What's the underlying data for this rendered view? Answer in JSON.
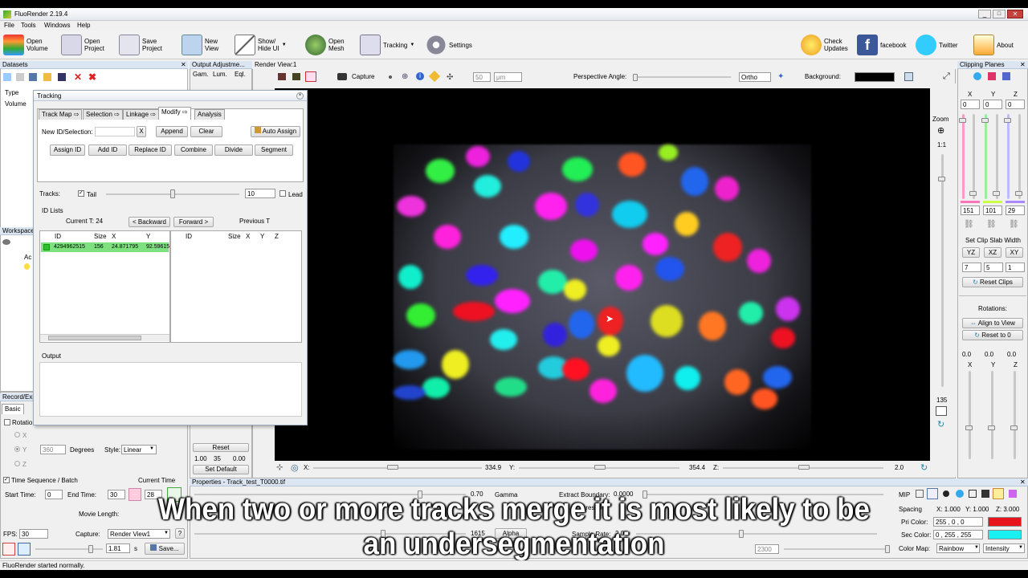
{
  "window": {
    "title": "FluoRender 2.19.4"
  },
  "menu": [
    "File",
    "Tools",
    "Windows",
    "Help"
  ],
  "toolbar": {
    "open_volume": "Open\nVolume",
    "open_project": "Open\nProject",
    "save_project": "Save\nProject",
    "new_view": "New\nView",
    "show_hide_ui": "Show/\nHide UI",
    "open_mesh": "Open\nMesh",
    "tracking": "Tracking",
    "settings": "Settings",
    "check_updates": "Check\nUpdates",
    "facebook": "facebook",
    "twitter": "Twitter",
    "about": "About"
  },
  "datasets": {
    "title": "Datasets",
    "col_type": "Type",
    "row_volume": "Volume"
  },
  "workspace": {
    "title": "Workspace",
    "item": "Ac"
  },
  "output_adjust": {
    "title": "Output Adjustme...",
    "gam": "Gam.",
    "lum": "Lum.",
    "eql": "Eql.",
    "reset": "Reset",
    "vals": [
      "1.00",
      "35",
      "0.00"
    ],
    "set_default": "Set Default"
  },
  "tracking": {
    "title": "Tracking",
    "tabs": [
      "Track Map ⇨",
      "Selection ⇨",
      "Linkage ⇨",
      "Modify ⇨",
      "Analysis"
    ],
    "new_id_label": "New ID/Selection:",
    "x_btn": "X",
    "append": "Append",
    "clear": "Clear",
    "auto_assign": "Auto Assign",
    "actions": [
      "Assign ID",
      "Add ID",
      "Replace ID",
      "Combine",
      "Divide",
      "Segment"
    ],
    "tracks_label": "Tracks:",
    "tail": "Tail",
    "tail_value": "10",
    "lead": "Lead",
    "id_lists": "ID Lists",
    "current_t": "Current T: 24",
    "backward": "< Backward",
    "forward": "Forward >",
    "previous_t": "Previous T",
    "left_cols": [
      "ID",
      "Size",
      "X",
      "Y"
    ],
    "left_row": [
      "4294962515",
      "156",
      "24.871795",
      "92.59615"
    ],
    "right_cols": [
      "ID",
      "Size",
      "X",
      "Y",
      "Z"
    ],
    "output_label": "Output"
  },
  "render_view": {
    "title": "Render View:1",
    "capture": "Capture",
    "scale_value": "50",
    "scale_unit": "μm",
    "perspective": "Perspective Angle:",
    "ortho": "Ortho",
    "background": "Background:",
    "bottom": {
      "x_label": "X:",
      "x_val": "334.9",
      "y_label": "Y:",
      "y_val": "354.4",
      "z_label": "Z:",
      "z_val": "2.0"
    }
  },
  "zoom": {
    "label": "Zoom",
    "ratio": "1:1",
    "value": "135"
  },
  "clipping": {
    "title": "Clipping Planes",
    "axes": [
      "X",
      "Y",
      "Z"
    ],
    "top_vals": [
      "0",
      "0",
      "0"
    ],
    "bottom_vals": [
      "151",
      "101",
      "29"
    ],
    "slab_label": "Set Clip Slab Width",
    "slab_btns": [
      "YZ",
      "XZ",
      "XY"
    ],
    "slab_vals": [
      "7",
      "5",
      "1"
    ],
    "reset_clips": "Reset Clips",
    "rotations": "Rotations:",
    "align_to_view": "Align to View",
    "reset_to_0": "Reset to 0",
    "rot_vals": [
      "0.0",
      "0.0",
      "0.0"
    ]
  },
  "record": {
    "title": "Record/Exp",
    "tab_basic": "Basic",
    "rotation": "Rotatio",
    "axes": [
      "X",
      "Y",
      "Z"
    ],
    "degrees_val": "360",
    "degrees": "Degrees",
    "style_label": "Style:",
    "style_val": "Linear",
    "time_seq": "Time Sequence / Batch",
    "current_time": "Current Time",
    "start_time": "Start Time:",
    "start_val": "0",
    "end_time": "End Time:",
    "end_val": "30",
    "cur_val": "28",
    "movie_length": "Movie Length:",
    "fps_label": "FPS:",
    "fps_val": "30",
    "capture_label": "Capture:",
    "capture_val": "Render View1",
    "length_val": "1.81",
    "s": "s",
    "save": "Save..."
  },
  "properties": {
    "title": "Properties - Track_test_T0000.tif",
    "gamma_val": "0.70",
    "gamma": "Gamma",
    "extract_boundary": "Extract Boundary:",
    "eb_val": "0.0000",
    "threshold": "Threshol",
    "val1615": "1615",
    "alpha": "Alpha",
    "sample_rate": "Sample Rate:",
    "sr_val": "2.0",
    "val2300": "2300",
    "mip": "MIP",
    "spacing": "Spacing",
    "sx": "X: 1.000",
    "sy": "Y: 1.000",
    "sz": "Z: 3.000",
    "pri_color": "Pri Color:",
    "pri_val": "255 , 0 , 0",
    "sec_color": "Sec Color:",
    "sec_val": "0 , 255 , 255",
    "color_map": "Color Map:",
    "cmap_val": "Rainbow",
    "cmap_mode": "Intensity",
    "pri_hex": "#e8141c",
    "sec_hex": "#19f0f2"
  },
  "subtitle": {
    "line1": "When two or more tracks merge it is most likely to be",
    "line2": "an undersegmentation"
  },
  "status": "FluoRender started normally."
}
